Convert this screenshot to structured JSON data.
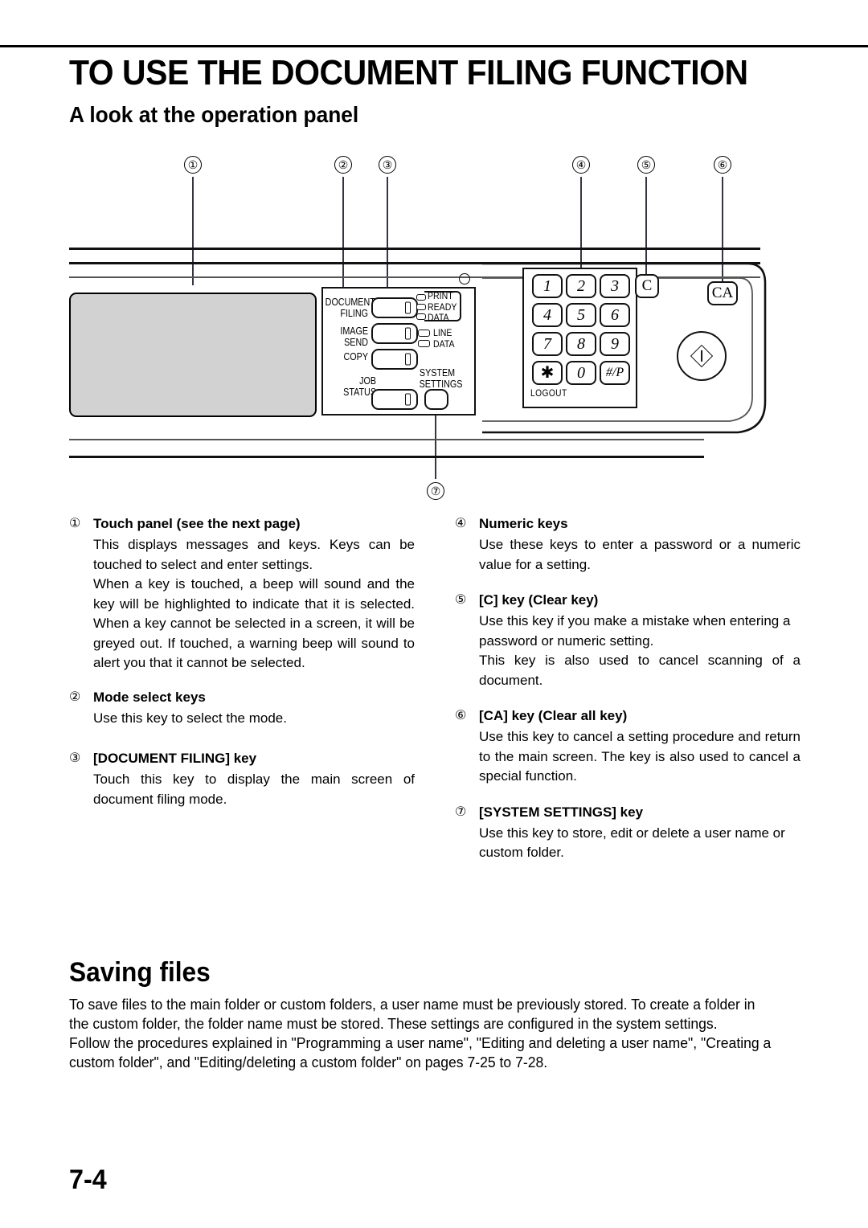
{
  "header": {
    "title": "TO USE THE DOCUMENT FILING FUNCTION",
    "subtitle": "A look at the operation panel"
  },
  "figure": {
    "callouts": [
      "①",
      "②",
      "③",
      "④",
      "⑤",
      "⑥",
      "⑦"
    ],
    "mode_keys": [
      {
        "label": "DOCUMENT\nFILING"
      },
      {
        "label": "IMAGE SEND"
      },
      {
        "label": "COPY"
      },
      {
        "label": "JOB STATUS"
      }
    ],
    "system_settings_label": "SYSTEM\nSETTINGS",
    "led_group_bracket": [
      "PRINT",
      "READY",
      "DATA"
    ],
    "led_group_plain": [
      "LINE",
      "DATA"
    ],
    "numeric_keys": [
      "1",
      "2",
      "3",
      "4",
      "5",
      "6",
      "7",
      "8",
      "9",
      "✱",
      "0",
      "#/P"
    ],
    "logout_label": "LOGOUT",
    "clear_key": "C",
    "clear_all_key": "CA"
  },
  "descriptions": {
    "left": [
      {
        "marker": "①",
        "title": "Touch panel (see the next page)",
        "paragraphs": [
          "This displays messages and keys. Keys can be touched to select and enter settings.",
          "When a key is touched, a beep will sound and the key will be highlighted to indicate that it is selected. When a key cannot be selected in a screen, it will be greyed out. If touched, a warning beep will sound to alert you that it cannot be selected."
        ]
      },
      {
        "marker": "②",
        "title": "Mode select keys",
        "paragraphs": [
          "Use this key to select the mode."
        ]
      },
      {
        "marker": "③",
        "title": "[DOCUMENT FILING] key",
        "paragraphs": [
          "Touch this key to display the main screen of document filing mode."
        ]
      }
    ],
    "right": [
      {
        "marker": "④",
        "title": "Numeric keys",
        "paragraphs": [
          "Use these keys to enter a password or a numeric value for a setting."
        ]
      },
      {
        "marker": "⑤",
        "title": "[C] key (Clear key)",
        "paragraphs": [
          "Use this key if you make a mistake when entering a password or numeric setting.",
          "This key is also used to cancel scanning of a document."
        ]
      },
      {
        "marker": "⑥",
        "title": "[CA] key (Clear all key)",
        "paragraphs": [
          "Use this key to cancel a setting procedure and return to the main screen. The key is also used to cancel a special function."
        ]
      },
      {
        "marker": "⑦",
        "title": "[SYSTEM SETTINGS] key",
        "paragraphs": [
          "Use this key to store, edit or delete a user name or custom folder."
        ]
      }
    ]
  },
  "saving": {
    "title": "Saving files",
    "paragraphs": [
      "To save files to the main folder or custom folders, a user name must be previously stored. To create a folder in the custom folder, the folder name must be stored. These settings are configured in the system settings.",
      "Follow the procedures explained in \"Programming a user name\", \"Editing and deleting a user name\", \"Creating a custom folder\", and \"Editing/deleting a custom folder\" on pages 7-25 to 7-28."
    ]
  },
  "footer": {
    "page_number": "7-4"
  }
}
